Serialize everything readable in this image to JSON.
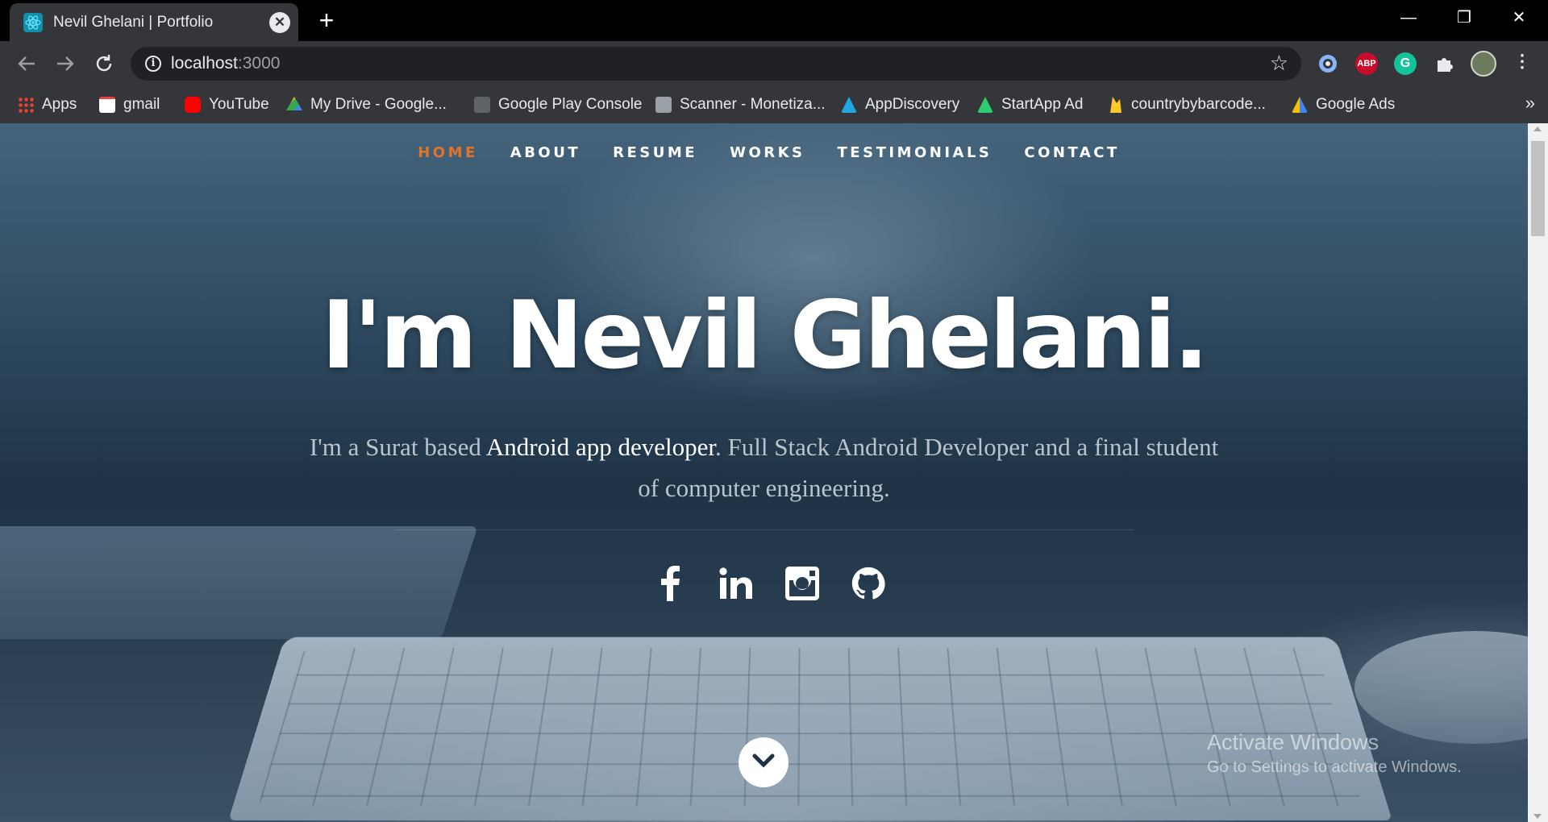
{
  "browser": {
    "tab_title": "Nevil Ghelani | Portfolio",
    "tab_close": "✕",
    "new_tab": "+",
    "url_host": "localhost",
    "url_port": ":3000",
    "window_controls": [
      "—",
      "❐",
      "✕"
    ],
    "bookmarks": [
      {
        "label": "Apps",
        "icon": "apps-grid-icon",
        "color": "#4285f4"
      },
      {
        "label": "gmail",
        "icon": "gmail-icon",
        "color": "#ea4335"
      },
      {
        "label": "YouTube",
        "icon": "youtube-icon",
        "color": "#ff0000"
      },
      {
        "label": "My Drive - Google...",
        "icon": "google-drive-icon",
        "color": "#fbbc04"
      },
      {
        "label": "Google Play Console",
        "icon": "play-console-icon",
        "color": "#5f6368"
      },
      {
        "label": "Scanner - Monetiza...",
        "icon": "scanner-icon",
        "color": "#9aa0a6"
      },
      {
        "label": "AppDiscovery",
        "icon": "appdiscovery-icon",
        "color": "#1ea7e1"
      },
      {
        "label": "StartApp Ad",
        "icon": "startapp-icon",
        "color": "#2ecc71"
      },
      {
        "label": "countrybybarcode...",
        "icon": "firebase-icon",
        "color": "#ffca28"
      },
      {
        "label": "Google Ads",
        "icon": "google-ads-icon",
        "color": "#4285f4"
      }
    ],
    "bookmarks_more": "»",
    "extensions": [
      {
        "icon": "extension-circle-icon",
        "label": "",
        "color": "#8ab4f8"
      },
      {
        "icon": "adblock-plus-icon",
        "label": "ABP",
        "color": "#c70d2c"
      },
      {
        "icon": "grammarly-icon",
        "label": "G",
        "color": "#15c39a"
      }
    ]
  },
  "site": {
    "nav": [
      "HOME",
      "ABOUT",
      "RESUME",
      "WORKS",
      "TESTIMONIALS",
      "CONTACT"
    ],
    "headline": "I'm Nevil Ghelani.",
    "intro_part1": "I'm a Surat based ",
    "intro_highlight": "Android app developer",
    "intro_part2": ". Full Stack Android Developer and a final student of computer engineering.",
    "socials": [
      "facebook-icon",
      "linkedin-icon",
      "instagram-icon",
      "github-icon"
    ],
    "accent_color": "#e0742c"
  },
  "watermark": {
    "line1": "Activate Windows",
    "line2": "Go to Settings to activate Windows."
  }
}
